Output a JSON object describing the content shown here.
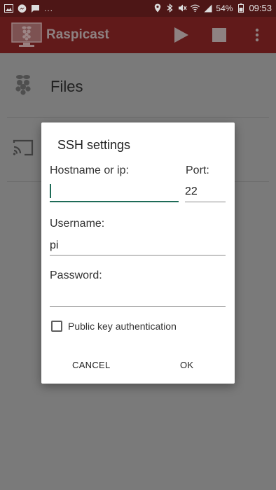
{
  "status_bar": {
    "battery": "54%",
    "time": "09:53",
    "more_glyph": "..."
  },
  "app_bar": {
    "title": "Raspicast",
    "icons": [
      "raspberry-screen-icon",
      "play-icon",
      "stop-icon",
      "more-vert-icon"
    ]
  },
  "list": {
    "items": [
      {
        "label": "Files",
        "icon": "raspberry-icon"
      },
      {
        "label": "",
        "icon": "cast-icon"
      }
    ]
  },
  "dialog": {
    "title": "SSH settings",
    "hostname_label": "Hostname or ip:",
    "hostname_value": "",
    "port_label": "Port:",
    "port_value": "22",
    "username_label": "Username:",
    "username_value": "pi",
    "password_label": "Password:",
    "password_value": "",
    "public_key_label": "Public key authentication",
    "public_key_checked": false,
    "cancel_label": "CANCEL",
    "ok_label": "OK"
  },
  "colors": {
    "status_bar": "#4d1616",
    "app_bar": "#611a1a",
    "accent": "#1e6b57",
    "overlay_background": "#7a7a7a"
  }
}
